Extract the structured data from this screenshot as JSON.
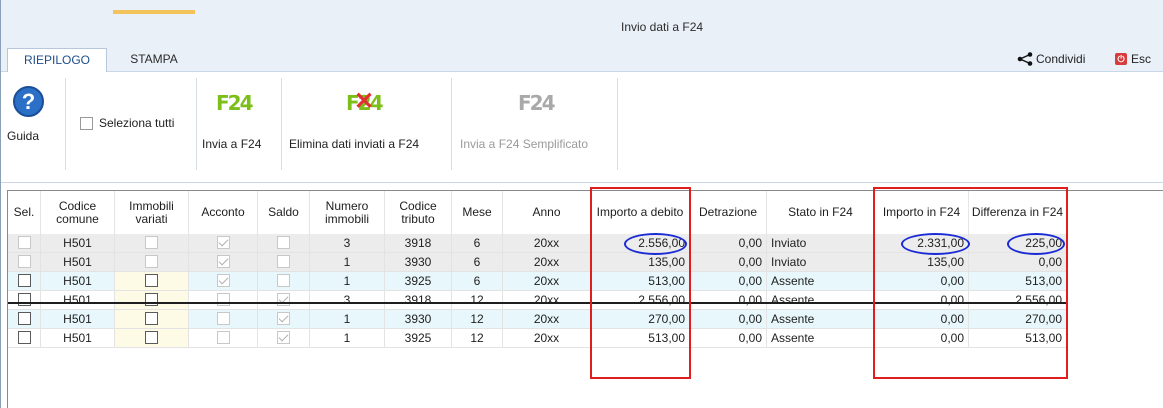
{
  "window": {
    "title": "Invio dati a F24"
  },
  "tabs": [
    {
      "label": "RIEPILOGO"
    },
    {
      "label": "STAMPA"
    }
  ],
  "header_actions": {
    "share": "Condividi",
    "exit": "Esc"
  },
  "ribbon": {
    "guida": "Guida",
    "select_all": "Seleziona tutti",
    "invia": "Invia a F24",
    "elimina": "Elimina dati inviati a F24",
    "semplificato": "Invia a F24 Semplificato",
    "f24_glyph": "F24"
  },
  "table": {
    "columns": [
      "Sel.",
      "Codice comune",
      "Immobili variati",
      "Acconto",
      "Saldo",
      "Numero immobili",
      "Codice tributo",
      "Mese",
      "Anno",
      "Importo a debito",
      "Detrazione",
      "Stato in F24",
      "Importo in F24",
      "Differenza in F24"
    ],
    "rows": [
      {
        "codice": "H501",
        "numero": "3",
        "tributo": "3918",
        "mese": "6",
        "anno": "20xx",
        "importo": "2.556,00",
        "detrazione": "0,00",
        "stato": "Inviato",
        "importo_f24": "2.331,00",
        "differenza": "225,00",
        "sel_enabled": false,
        "acconto": true,
        "saldo": false
      },
      {
        "codice": "H501",
        "numero": "1",
        "tributo": "3930",
        "mese": "6",
        "anno": "20xx",
        "importo": "135,00",
        "detrazione": "0,00",
        "stato": "Inviato",
        "importo_f24": "135,00",
        "differenza": "0,00",
        "sel_enabled": false,
        "acconto": true,
        "saldo": false
      },
      {
        "codice": "H501",
        "numero": "1",
        "tributo": "3925",
        "mese": "6",
        "anno": "20xx",
        "importo": "513,00",
        "detrazione": "0,00",
        "stato": "Assente",
        "importo_f24": "0,00",
        "differenza": "513,00",
        "sel_enabled": true,
        "acconto": true,
        "saldo": false
      },
      {
        "codice": "H501",
        "numero": "3",
        "tributo": "3918",
        "mese": "12",
        "anno": "20xx",
        "importo": "2.556,00",
        "detrazione": "0,00",
        "stato": "Assente",
        "importo_f24": "0,00",
        "differenza": "2.556,00",
        "sel_enabled": true,
        "acconto": false,
        "saldo": true
      },
      {
        "codice": "H501",
        "numero": "1",
        "tributo": "3930",
        "mese": "12",
        "anno": "20xx",
        "importo": "270,00",
        "detrazione": "0,00",
        "stato": "Assente",
        "importo_f24": "0,00",
        "differenza": "270,00",
        "sel_enabled": true,
        "acconto": false,
        "saldo": true
      },
      {
        "codice": "H501",
        "numero": "1",
        "tributo": "3925",
        "mese": "12",
        "anno": "20xx",
        "importo": "513,00",
        "detrazione": "0,00",
        "stato": "Assente",
        "importo_f24": "0,00",
        "differenza": "513,00",
        "sel_enabled": true,
        "acconto": false,
        "saldo": true
      }
    ]
  },
  "colors": {
    "highlight_box": "#e01e1e",
    "highlight_oval": "#1a2bd6",
    "f24_icon": "#7dbf1a",
    "delete_x": "#e03030"
  }
}
